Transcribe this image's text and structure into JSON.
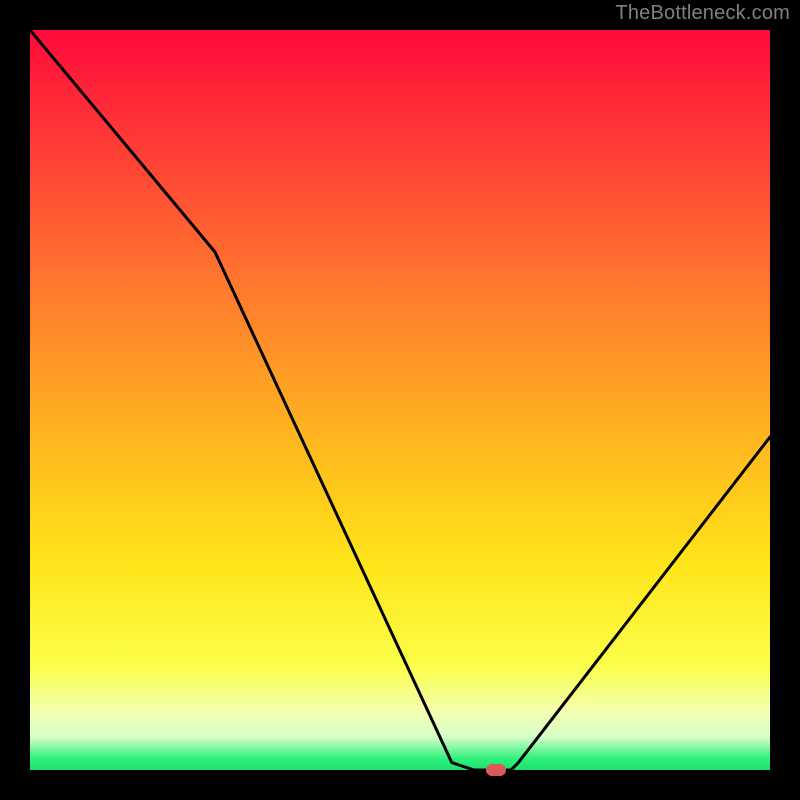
{
  "watermark": "TheBottleneck.com",
  "chart_data": {
    "type": "line",
    "title": "",
    "xlabel": "",
    "ylabel": "",
    "xlim": [
      0,
      100
    ],
    "ylim": [
      0,
      100
    ],
    "curve": [
      {
        "x": 0,
        "y": 100
      },
      {
        "x": 25,
        "y": 70
      },
      {
        "x": 57,
        "y": 1
      },
      {
        "x": 60,
        "y": 0
      },
      {
        "x": 65,
        "y": 0
      },
      {
        "x": 66,
        "y": 1
      },
      {
        "x": 100,
        "y": 45
      }
    ],
    "marker": {
      "x": 63,
      "y": 0,
      "color": "#da5a5a"
    },
    "gradient_stops": [
      {
        "offset": 0.0,
        "color": "#ff0a3a"
      },
      {
        "offset": 0.15,
        "color": "#ff3a36"
      },
      {
        "offset": 0.35,
        "color": "#ff7a2e"
      },
      {
        "offset": 0.55,
        "color": "#ffb51f"
      },
      {
        "offset": 0.72,
        "color": "#ffe419"
      },
      {
        "offset": 0.86,
        "color": "#fbff4a"
      },
      {
        "offset": 0.92,
        "color": "#f4ffb0"
      },
      {
        "offset": 0.955,
        "color": "#d8ffc8"
      },
      {
        "offset": 0.985,
        "color": "#2df07a"
      },
      {
        "offset": 1.0,
        "color": "#20e070"
      }
    ]
  },
  "styles": {
    "curve_color": "#000000",
    "curve_width": 3,
    "plot_bg_black": "#000000"
  }
}
